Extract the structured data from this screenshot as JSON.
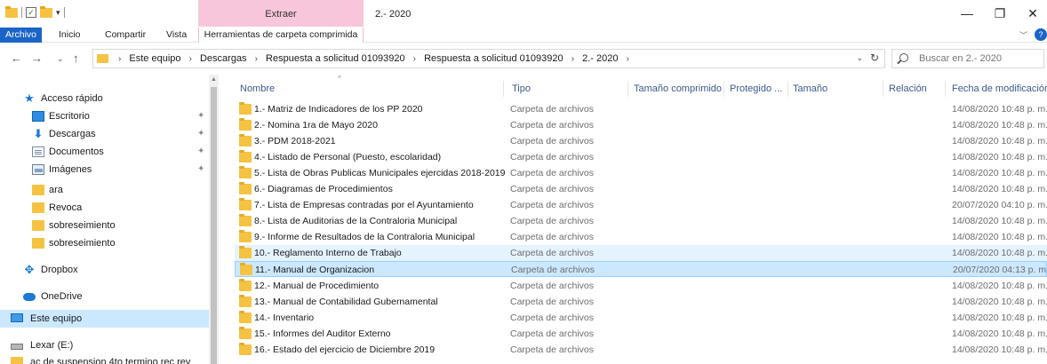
{
  "window": {
    "context_tab_title": "Extraer",
    "title": "2.- 2020",
    "minimize_glyph": "—",
    "maximize_glyph": "❐",
    "close_glyph": "✕"
  },
  "ribbon": {
    "tabs": [
      "Archivo",
      "Inicio",
      "Compartir",
      "Vista"
    ],
    "context_tab": "Herramientas de carpeta comprimida",
    "help_glyph": "?"
  },
  "address": {
    "breadcrumbs": [
      "Este equipo",
      "Descargas",
      "Respuesta a solicitud 01093920",
      "Respuesta a solicitud 01093920",
      "2.- 2020"
    ],
    "search_placeholder": "Buscar en 2.- 2020"
  },
  "nav_pane": {
    "quick_access": "Acceso rápido",
    "items": [
      {
        "label": "Escritorio",
        "icon": "desktop-icon",
        "pinned": true
      },
      {
        "label": "Descargas",
        "icon": "download-icon",
        "pinned": true
      },
      {
        "label": "Documentos",
        "icon": "documents-icon",
        "pinned": true
      },
      {
        "label": "Imágenes",
        "icon": "pictures-icon",
        "pinned": true
      },
      {
        "label": "ara",
        "icon": "folder-icon",
        "pinned": false
      },
      {
        "label": "Revoca",
        "icon": "folder-icon",
        "pinned": false
      },
      {
        "label": "sobreseimiento",
        "icon": "folder-icon",
        "pinned": false
      },
      {
        "label": "sobreseimiento",
        "icon": "folder-icon",
        "pinned": false
      }
    ],
    "dropbox": "Dropbox",
    "onedrive": "OneDrive",
    "this_pc": "Este equipo",
    "drive": "Lexar (E:)",
    "drive_child": "ac de suspension 4to termino rec rev"
  },
  "columns": [
    "Nombre",
    "Tipo",
    "Tamaño comprimido",
    "Protegido ...",
    "Tamaño",
    "Relación",
    "Fecha de modificación"
  ],
  "rows": [
    {
      "name": "1.- Matriz de Indicadores de los PP 2020",
      "type": "Carpeta de archivos",
      "date": "14/08/2020 10:48 p. m."
    },
    {
      "name": "2.- Nomina 1ra de Mayo 2020",
      "type": "Carpeta de archivos",
      "date": "14/08/2020 10:48 p. m."
    },
    {
      "name": "3.- PDM 2018-2021",
      "type": "Carpeta de archivos",
      "date": "14/08/2020 10:48 p. m."
    },
    {
      "name": "4.- Listado de Personal (Puesto, escolaridad)",
      "type": "Carpeta de archivos",
      "date": "14/08/2020 10:48 p. m."
    },
    {
      "name": "5.- Lista de Obras Publicas Municipales ejercidas 2018-2019",
      "type": "Carpeta de archivos",
      "date": "14/08/2020 10:48 p. m."
    },
    {
      "name": "6.- Diagramas de Procedimientos",
      "type": "Carpeta de archivos",
      "date": "14/08/2020 10:48 p. m."
    },
    {
      "name": "7.- Lista de Empresas contradas por el Ayuntamiento",
      "type": "Carpeta de archivos",
      "date": "20/07/2020 04:10 p. m."
    },
    {
      "name": "8.- Lista de Auditorias de la Contraloria Municipal",
      "type": "Carpeta de archivos",
      "date": "14/08/2020 10:48 p. m."
    },
    {
      "name": "9.- Informe de Resultados de la Contraloria Municipal",
      "type": "Carpeta de archivos",
      "date": "14/08/2020 10:48 p. m."
    },
    {
      "name": "10.- Reglamento Interno de Trabajo",
      "type": "Carpeta de archivos",
      "date": "14/08/2020 10:48 p. m."
    },
    {
      "name": "11.- Manual de Organizacion",
      "type": "Carpeta de archivos",
      "date": "20/07/2020 04:13 p. m."
    },
    {
      "name": "12.- Manual de Procedimiento",
      "type": "Carpeta de archivos",
      "date": "14/08/2020 10:48 p. m."
    },
    {
      "name": "13.- Manual de Contabilidad Gubernamental",
      "type": "Carpeta de archivos",
      "date": "14/08/2020 10:48 p. m."
    },
    {
      "name": "14.- Inventario",
      "type": "Carpeta de archivos",
      "date": "14/08/2020 10:48 p. m."
    },
    {
      "name": "15.- Informes del Auditor Externo",
      "type": "Carpeta de archivos",
      "date": "14/08/2020 10:48 p. m."
    },
    {
      "name": "16.- Estado del ejercicio de Diciembre 2019",
      "type": "Carpeta de archivos",
      "date": "14/08/2020 10:48 p. m."
    }
  ]
}
